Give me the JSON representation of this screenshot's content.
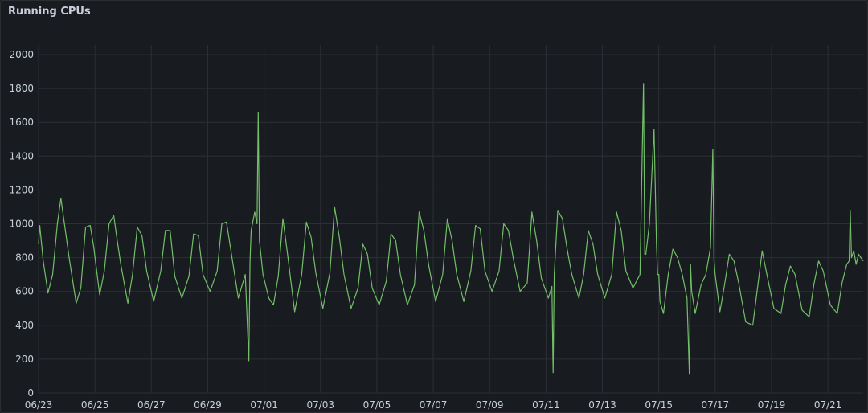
{
  "panel": {
    "title": "Running CPUs"
  },
  "colors": {
    "background": "#181b1f",
    "grid": "#2c2f35",
    "series": "#73bf69",
    "text": "#c7d0d9"
  },
  "chart_data": {
    "type": "line",
    "title": "Running CPUs",
    "xlabel": "",
    "ylabel": "",
    "ylim": [
      0,
      2000
    ],
    "yticks": [
      0,
      200,
      400,
      600,
      800,
      1000,
      1200,
      1400,
      1600,
      1800,
      2000
    ],
    "xlim": [
      "2023-06-23",
      "2023-07-22T06:00"
    ],
    "xticks": [
      {
        "date": "2023-06-23",
        "label": "06/23"
      },
      {
        "date": "2023-06-25",
        "label": "06/25"
      },
      {
        "date": "2023-06-27",
        "label": "06/27"
      },
      {
        "date": "2023-06-29",
        "label": "06/29"
      },
      {
        "date": "2023-07-01",
        "label": "07/01"
      },
      {
        "date": "2023-07-03",
        "label": "07/03"
      },
      {
        "date": "2023-07-05",
        "label": "07/05"
      },
      {
        "date": "2023-07-07",
        "label": "07/07"
      },
      {
        "date": "2023-07-09",
        "label": "07/09"
      },
      {
        "date": "2023-07-11",
        "label": "07/11"
      },
      {
        "date": "2023-07-13",
        "label": "07/13"
      },
      {
        "date": "2023-07-15",
        "label": "07/15"
      },
      {
        "date": "2023-07-17",
        "label": "07/17"
      },
      {
        "date": "2023-07-19",
        "label": "07/19"
      },
      {
        "date": "2023-07-21",
        "label": "07/21"
      }
    ],
    "grid": true,
    "legend": "none",
    "series": [
      {
        "x": [
          "2023-06-23T00:00",
          "2023-06-23T01:00",
          "2023-06-23T04:00",
          "2023-06-23T08:00",
          "2023-06-23T12:00",
          "2023-06-23T16:00",
          "2023-06-23T19:00",
          "2023-06-23T22:00",
          "2023-06-24T02:00",
          "2023-06-24T08:00",
          "2023-06-24T12:00",
          "2023-06-24T16:00",
          "2023-06-24T20:00",
          "2023-06-24T23:00",
          "2023-06-25T04:00",
          "2023-06-25T08:00",
          "2023-06-25T12:00",
          "2023-06-25T16:00",
          "2023-06-25T19:00",
          "2023-06-25T22:00",
          "2023-06-26T04:00",
          "2023-06-26T08:00",
          "2023-06-26T12:00",
          "2023-06-26T16:00",
          "2023-06-26T20:00",
          "2023-06-27T02:00",
          "2023-06-27T08:00",
          "2023-06-27T12:00",
          "2023-06-27T16:00",
          "2023-06-27T20:00",
          "2023-06-28T02:00",
          "2023-06-28T08:00",
          "2023-06-28T12:00",
          "2023-06-28T16:00",
          "2023-06-28T20:00",
          "2023-06-29T02:00",
          "2023-06-29T08:00",
          "2023-06-29T12:00",
          "2023-06-29T16:00",
          "2023-06-29T20:00",
          "2023-06-30T02:00",
          "2023-06-30T08:00",
          "2023-06-30T11:00",
          "2023-06-30T12:00",
          "2023-06-30T13:00",
          "2023-06-30T16:00",
          "2023-06-30T18:00",
          "2023-06-30T19:00",
          "2023-06-30T20:00",
          "2023-06-30T23:00",
          "2023-07-01T04:00",
          "2023-07-01T08:00",
          "2023-07-01T12:00",
          "2023-07-01T16:00",
          "2023-07-01T20:00",
          "2023-07-02T02:00",
          "2023-07-02T08:00",
          "2023-07-02T12:00",
          "2023-07-02T16:00",
          "2023-07-02T20:00",
          "2023-07-03T02:00",
          "2023-07-03T08:00",
          "2023-07-03T12:00",
          "2023-07-03T16:00",
          "2023-07-03T20:00",
          "2023-07-04T02:00",
          "2023-07-04T08:00",
          "2023-07-04T12:00",
          "2023-07-04T16:00",
          "2023-07-04T20:00",
          "2023-07-05T02:00",
          "2023-07-05T08:00",
          "2023-07-05T12:00",
          "2023-07-05T16:00",
          "2023-07-05T20:00",
          "2023-07-06T02:00",
          "2023-07-06T08:00",
          "2023-07-06T12:00",
          "2023-07-06T16:00",
          "2023-07-06T20:00",
          "2023-07-07T02:00",
          "2023-07-07T08:00",
          "2023-07-07T12:00",
          "2023-07-07T16:00",
          "2023-07-07T20:00",
          "2023-07-08T02:00",
          "2023-07-08T08:00",
          "2023-07-08T12:00",
          "2023-07-08T16:00",
          "2023-07-08T20:00",
          "2023-07-09T02:00",
          "2023-07-09T08:00",
          "2023-07-09T12:00",
          "2023-07-09T16:00",
          "2023-07-09T20:00",
          "2023-07-10T02:00",
          "2023-07-10T08:00",
          "2023-07-10T12:00",
          "2023-07-10T16:00",
          "2023-07-10T20:00",
          "2023-07-11T02:00",
          "2023-07-11T05:00",
          "2023-07-11T06:00",
          "2023-07-11T07:00",
          "2023-07-11T10:00",
          "2023-07-11T14:00",
          "2023-07-11T18:00",
          "2023-07-11T22:00",
          "2023-07-12T04:00",
          "2023-07-12T08:00",
          "2023-07-12T12:00",
          "2023-07-12T16:00",
          "2023-07-12T20:00",
          "2023-07-13T02:00",
          "2023-07-13T08:00",
          "2023-07-13T12:00",
          "2023-07-13T16:00",
          "2023-07-13T20:00",
          "2023-07-14T02:00",
          "2023-07-14T08:00",
          "2023-07-14T11:00",
          "2023-07-14T12:00",
          "2023-07-14T13:00",
          "2023-07-14T16:00",
          "2023-07-14T20:00",
          "2023-07-14T22:00",
          "2023-07-14T23:00",
          "2023-07-15T00:00",
          "2023-07-15T01:00",
          "2023-07-15T04:00",
          "2023-07-15T08:00",
          "2023-07-15T12:00",
          "2023-07-15T16:00",
          "2023-07-15T20:00",
          "2023-07-16T00:00",
          "2023-07-16T02:00",
          "2023-07-16T03:00",
          "2023-07-16T04:00",
          "2023-07-16T07:00",
          "2023-07-16T12:00",
          "2023-07-16T16:00",
          "2023-07-16T20:00",
          "2023-07-16T22:00",
          "2023-07-16T23:00",
          "2023-07-17T00:00",
          "2023-07-17T04:00",
          "2023-07-17T08:00",
          "2023-07-17T12:00",
          "2023-07-17T16:00",
          "2023-07-17T20:00",
          "2023-07-18T02:00",
          "2023-07-18T08:00",
          "2023-07-18T12:00",
          "2023-07-18T16:00",
          "2023-07-18T20:00",
          "2023-07-19T02:00",
          "2023-07-19T08:00",
          "2023-07-19T12:00",
          "2023-07-19T16:00",
          "2023-07-19T20:00",
          "2023-07-20T02:00",
          "2023-07-20T08:00",
          "2023-07-20T12:00",
          "2023-07-20T16:00",
          "2023-07-20T20:00",
          "2023-07-21T02:00",
          "2023-07-21T08:00",
          "2023-07-21T12:00",
          "2023-07-21T16:00",
          "2023-07-21T18:00",
          "2023-07-21T19:00",
          "2023-07-21T20:00",
          "2023-07-21T22:00",
          "2023-07-22T00:00",
          "2023-07-22T02:00",
          "2023-07-22T04:00",
          "2023-07-22T06:00"
        ],
        "y": [
          880,
          990,
          780,
          590,
          700,
          1000,
          1150,
          1000,
          800,
          530,
          620,
          980,
          990,
          860,
          580,
          720,
          1000,
          1050,
          900,
          760,
          530,
          700,
          980,
          930,
          720,
          540,
          720,
          960,
          960,
          690,
          560,
          690,
          940,
          930,
          700,
          600,
          720,
          1000,
          1010,
          830,
          560,
          700,
          190,
          780,
          960,
          1070,
          1000,
          1660,
          900,
          700,
          560,
          520,
          690,
          1030,
          820,
          480,
          700,
          1010,
          920,
          710,
          500,
          710,
          1100,
          920,
          700,
          500,
          620,
          880,
          820,
          620,
          520,
          660,
          940,
          900,
          700,
          520,
          640,
          1070,
          960,
          760,
          540,
          700,
          1030,
          900,
          700,
          540,
          720,
          990,
          970,
          720,
          600,
          720,
          1000,
          960,
          800,
          600,
          650,
          1070,
          900,
          680,
          560,
          630,
          120,
          700,
          1080,
          1030,
          850,
          700,
          560,
          700,
          960,
          880,
          700,
          560,
          700,
          1070,
          960,
          720,
          620,
          700,
          1830,
          820,
          820,
          1000,
          1560,
          880,
          700,
          700,
          540,
          470,
          700,
          850,
          800,
          700,
          560,
          110,
          760,
          600,
          470,
          640,
          700,
          860,
          1440,
          780,
          700,
          480,
          640,
          820,
          780,
          650,
          420,
          400,
          620,
          840,
          700,
          500,
          470,
          640,
          750,
          700,
          490,
          450,
          640,
          780,
          720,
          520,
          470,
          650,
          760,
          780,
          1080,
          800,
          840,
          760,
          820,
          800,
          780
        ]
      }
    ]
  }
}
